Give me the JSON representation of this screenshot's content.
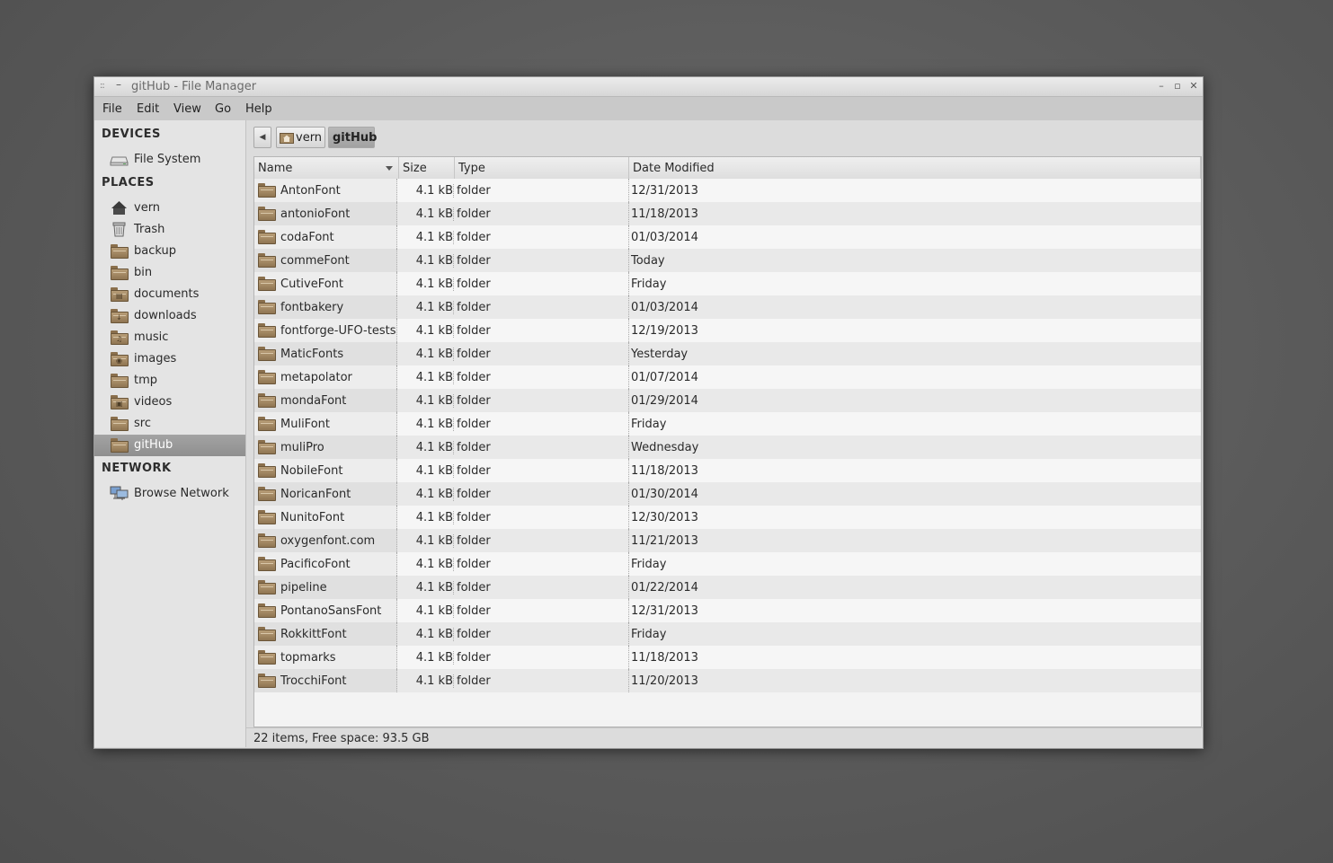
{
  "window": {
    "title": "gitHub - File Manager"
  },
  "menubar": {
    "items": [
      "File",
      "Edit",
      "View",
      "Go",
      "Help"
    ]
  },
  "sidebar": {
    "devices_heading": "DEVICES",
    "devices": [
      {
        "label": "File System",
        "icon": "drive-icon"
      }
    ],
    "places_heading": "PLACES",
    "places": [
      {
        "label": "vern",
        "icon": "home-icon"
      },
      {
        "label": "Trash",
        "icon": "trash-icon"
      },
      {
        "label": "backup",
        "icon": "folder-icon"
      },
      {
        "label": "bin",
        "icon": "folder-icon"
      },
      {
        "label": "documents",
        "icon": "documents-folder-icon"
      },
      {
        "label": "downloads",
        "icon": "downloads-folder-icon"
      },
      {
        "label": "music",
        "icon": "music-folder-icon"
      },
      {
        "label": "images",
        "icon": "images-folder-icon"
      },
      {
        "label": "tmp",
        "icon": "folder-icon"
      },
      {
        "label": "videos",
        "icon": "videos-folder-icon"
      },
      {
        "label": "src",
        "icon": "folder-icon"
      },
      {
        "label": "gitHub",
        "icon": "folder-icon",
        "selected": true
      }
    ],
    "network_heading": "NETWORK",
    "network": [
      {
        "label": "Browse Network",
        "icon": "network-icon"
      }
    ]
  },
  "pathbar": {
    "crumbs": [
      "vern",
      "gitHub"
    ],
    "active": "gitHub"
  },
  "columns": {
    "name": "Name",
    "size": "Size",
    "type": "Type",
    "date": "Date Modified"
  },
  "files": [
    {
      "name": "AntonFont",
      "size": "4.1 kB",
      "type": "folder",
      "date": "12/31/2013"
    },
    {
      "name": "antonioFont",
      "size": "4.1 kB",
      "type": "folder",
      "date": "11/18/2013"
    },
    {
      "name": "codaFont",
      "size": "4.1 kB",
      "type": "folder",
      "date": "01/03/2014"
    },
    {
      "name": "commeFont",
      "size": "4.1 kB",
      "type": "folder",
      "date": "Today"
    },
    {
      "name": "CutiveFont",
      "size": "4.1 kB",
      "type": "folder",
      "date": "Friday"
    },
    {
      "name": "fontbakery",
      "size": "4.1 kB",
      "type": "folder",
      "date": "01/03/2014"
    },
    {
      "name": "fontforge-UFO-tests",
      "size": "4.1 kB",
      "type": "folder",
      "date": "12/19/2013"
    },
    {
      "name": "MaticFonts",
      "size": "4.1 kB",
      "type": "folder",
      "date": "Yesterday"
    },
    {
      "name": "metapolator",
      "size": "4.1 kB",
      "type": "folder",
      "date": "01/07/2014"
    },
    {
      "name": "mondaFont",
      "size": "4.1 kB",
      "type": "folder",
      "date": "01/29/2014"
    },
    {
      "name": "MuliFont",
      "size": "4.1 kB",
      "type": "folder",
      "date": "Friday"
    },
    {
      "name": "muliPro",
      "size": "4.1 kB",
      "type": "folder",
      "date": "Wednesday"
    },
    {
      "name": "NobileFont",
      "size": "4.1 kB",
      "type": "folder",
      "date": "11/18/2013"
    },
    {
      "name": "NoricanFont",
      "size": "4.1 kB",
      "type": "folder",
      "date": "01/30/2014"
    },
    {
      "name": "NunitoFont",
      "size": "4.1 kB",
      "type": "folder",
      "date": "12/30/2013"
    },
    {
      "name": "oxygenfont.com",
      "size": "4.1 kB",
      "type": "folder",
      "date": "11/21/2013"
    },
    {
      "name": "PacificoFont",
      "size": "4.1 kB",
      "type": "folder",
      "date": "Friday"
    },
    {
      "name": "pipeline",
      "size": "4.1 kB",
      "type": "folder",
      "date": "01/22/2014"
    },
    {
      "name": "PontanoSansFont",
      "size": "4.1 kB",
      "type": "folder",
      "date": "12/31/2013"
    },
    {
      "name": "RokkittFont",
      "size": "4.1 kB",
      "type": "folder",
      "date": "Friday"
    },
    {
      "name": "topmarks",
      "size": "4.1 kB",
      "type": "folder",
      "date": "11/18/2013"
    },
    {
      "name": "TrocchiFont",
      "size": "4.1 kB",
      "type": "folder",
      "date": "11/20/2013"
    }
  ],
  "status": {
    "text": "22 items, Free space: 93.5 GB"
  }
}
